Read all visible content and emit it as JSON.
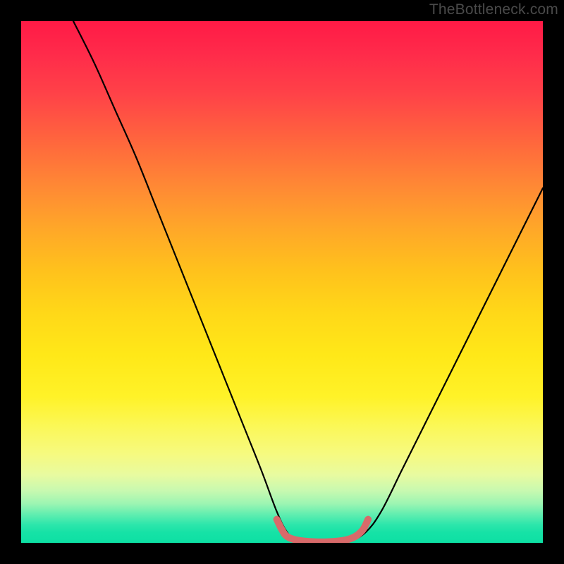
{
  "watermark": "TheBottleneck.com",
  "chart_data": {
    "type": "line",
    "title": "",
    "xlabel": "",
    "ylabel": "",
    "xlim": [
      0,
      100
    ],
    "ylim": [
      0,
      100
    ],
    "grid": false,
    "series": [
      {
        "name": "black-curve",
        "color": "#000000",
        "points": [
          {
            "x": 10,
            "y": 100
          },
          {
            "x": 14,
            "y": 92
          },
          {
            "x": 18,
            "y": 83
          },
          {
            "x": 22,
            "y": 74
          },
          {
            "x": 26,
            "y": 64
          },
          {
            "x": 30,
            "y": 54
          },
          {
            "x": 34,
            "y": 44
          },
          {
            "x": 38,
            "y": 34
          },
          {
            "x": 42,
            "y": 24
          },
          {
            "x": 46,
            "y": 14
          },
          {
            "x": 49,
            "y": 6
          },
          {
            "x": 51,
            "y": 2
          },
          {
            "x": 53,
            "y": 0.5
          },
          {
            "x": 58,
            "y": 0.2
          },
          {
            "x": 63,
            "y": 0.5
          },
          {
            "x": 66,
            "y": 2
          },
          {
            "x": 69,
            "y": 6
          },
          {
            "x": 73,
            "y": 14
          },
          {
            "x": 77,
            "y": 22
          },
          {
            "x": 82,
            "y": 32
          },
          {
            "x": 87,
            "y": 42
          },
          {
            "x": 92,
            "y": 52
          },
          {
            "x": 97,
            "y": 62
          },
          {
            "x": 100,
            "y": 68
          }
        ]
      },
      {
        "name": "red-flat-segment",
        "color": "#d86a6a",
        "points": [
          {
            "x": 49,
            "y": 4.5
          },
          {
            "x": 50,
            "y": 2.5
          },
          {
            "x": 51,
            "y": 1.2
          },
          {
            "x": 53,
            "y": 0.5
          },
          {
            "x": 56,
            "y": 0.2
          },
          {
            "x": 59,
            "y": 0.2
          },
          {
            "x": 62,
            "y": 0.5
          },
          {
            "x": 64,
            "y": 1.2
          },
          {
            "x": 65.5,
            "y": 2.5
          },
          {
            "x": 66.5,
            "y": 4.5
          }
        ]
      }
    ],
    "annotations": []
  }
}
